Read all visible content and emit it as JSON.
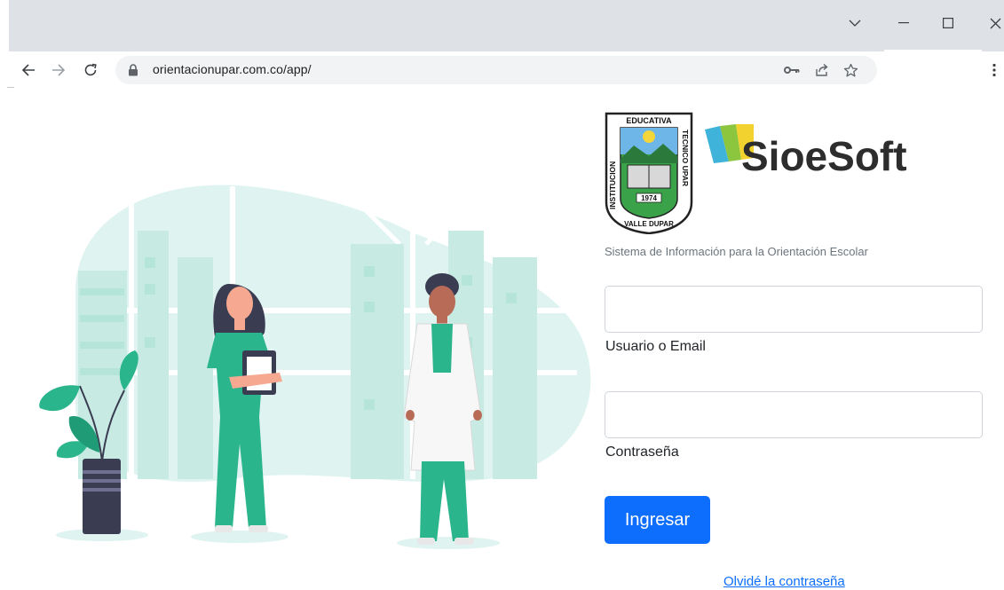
{
  "browser": {
    "url": "orientacionupar.com.co/app/"
  },
  "school_logo": {
    "top_text": "EDUCATIVA",
    "left_text": "INSTITUCION",
    "right_text": "TECNICO UPAR",
    "bottom_text": "VALLE DUPAR",
    "year": "1974"
  },
  "brand": {
    "name": "SioeSoft",
    "tagline": "Sistema de Información para la Orientación Escolar"
  },
  "form": {
    "username_label": "Usuario o Email",
    "username_value": "",
    "password_label": "Contraseña",
    "password_value": "",
    "submit_label": "Ingresar",
    "forgot_label": "Olvidé la contraseña"
  },
  "colors": {
    "primary": "#0d6efd",
    "illustration_teal": "#2bb58c",
    "illustration_bg": "#dff4f0",
    "brand_text": "#2d2d2d"
  },
  "icons": [
    "back-arrow-icon",
    "forward-arrow-icon",
    "reload-icon",
    "lock-icon",
    "key-icon",
    "share-icon",
    "star-icon",
    "kebab-menu-icon",
    "chevron-down-icon",
    "minimize-icon",
    "maximize-icon",
    "close-icon"
  ]
}
